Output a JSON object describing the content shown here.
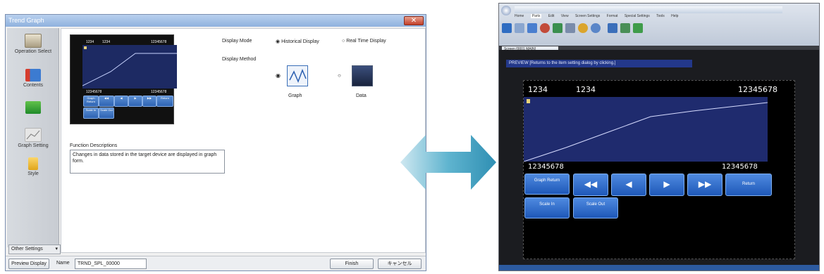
{
  "dialog": {
    "title": "Trend Graph",
    "close_symbol": "✕",
    "nav": [
      {
        "label": "Operation Select",
        "icon": "operation-select-icon"
      },
      {
        "label": "Contents",
        "icon": "contents-icon"
      },
      {
        "label": "",
        "icon": "data-blocks-icon"
      },
      {
        "label": "Graph Setting",
        "icon": "graph-setting-icon"
      },
      {
        "label": "Style",
        "icon": "style-icon"
      }
    ],
    "other_settings": "Other Settings",
    "display_mode": {
      "label": "Display Mode",
      "options": [
        "Historical Display",
        "Real Time Display"
      ],
      "selected": "Historical Display"
    },
    "display_method": {
      "label": "Display Method",
      "options": [
        "Graph",
        "Data"
      ],
      "selected": "Graph"
    },
    "function_descriptions": {
      "label": "Function Descriptions",
      "text": "Changes in data stored in the target device are displayed in graph form."
    },
    "preview": {
      "top_left": "1234",
      "top_mid": "1234",
      "top_right": "12345678",
      "bottom_left": "12345678",
      "bottom_right": "12345678",
      "buttons": [
        "Graph Return",
        "◀◀",
        "◀",
        "▶",
        "▶▶",
        "Return",
        "Scale In",
        "Scale Out"
      ]
    },
    "status": {
      "preview_button": "Preview Display",
      "name_label": "Name",
      "name_value": "TRND_SPL_00000",
      "finish_button": "Finish",
      "cancel_button": "キャンセル"
    }
  },
  "editor": {
    "ribbon_tabs": [
      "Home",
      "Parts",
      "Edit",
      "View",
      "Screen Settings",
      "Format",
      "Special Settings",
      "Tools",
      "Help"
    ],
    "doc_tab": "Screen [0001 MAIN]",
    "preview_caption": "PREVIEW [Returns to the item setting dialog by clicking.]",
    "graph": {
      "top_left": "1234",
      "top_mid": "1234",
      "top_right": "12345678",
      "bottom_left": "12345678",
      "bottom_right": "12345678"
    },
    "buttons": {
      "graph_return": "Graph Return",
      "fast_back": "◀◀",
      "back": "◀",
      "forward": "▶",
      "fast_forward": "▶▶",
      "return": "Return",
      "scale_in": "Scale In",
      "scale_out": "Scale Out"
    }
  },
  "colors": {
    "graph_bg": "#1f2b6e",
    "button_blue": "#2d63b3",
    "arrow_teal": "#5fb4cf"
  }
}
